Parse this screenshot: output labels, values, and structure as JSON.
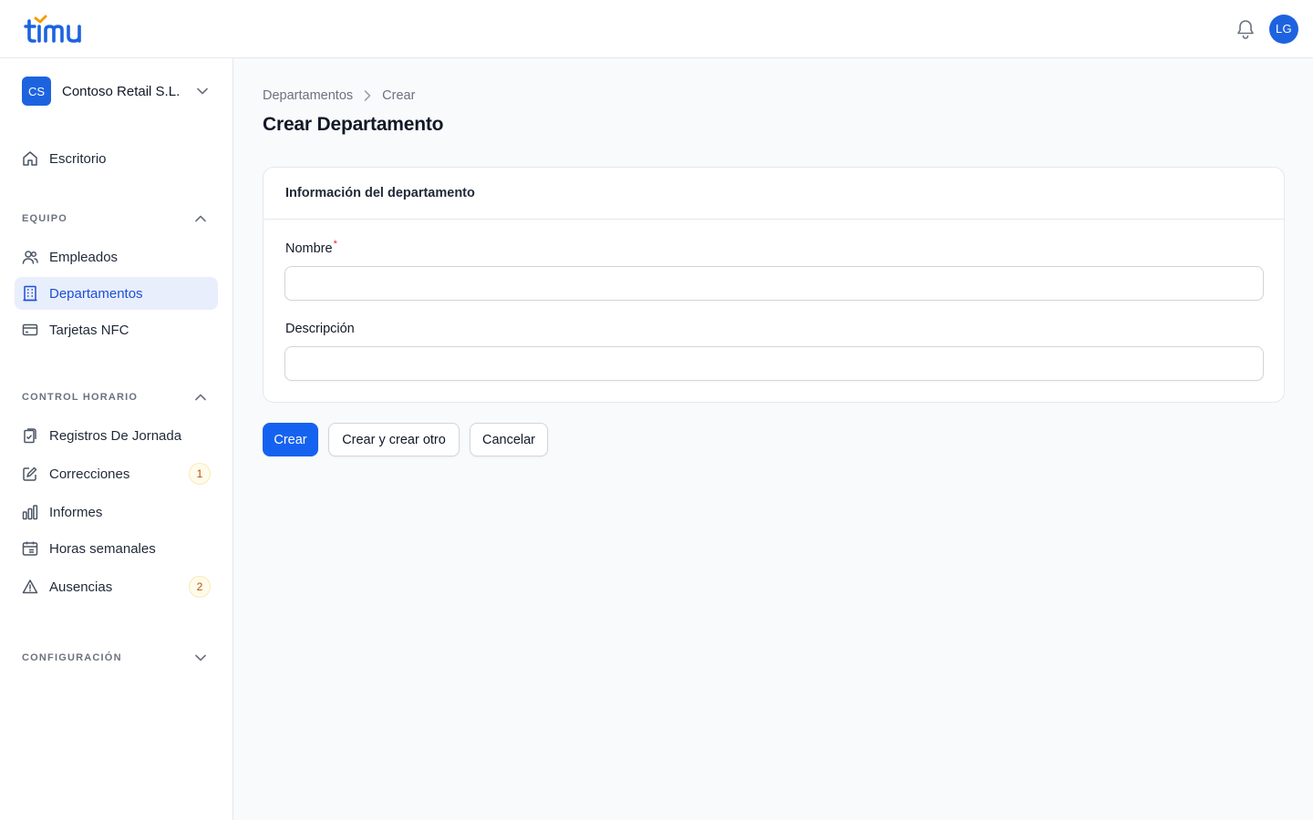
{
  "app": {
    "logo_text": "timu",
    "avatar_initials": "LG",
    "brand_color": "#1d63e0",
    "logo_accent": "#f59e0b"
  },
  "sidebar": {
    "tenant": {
      "initials": "CS",
      "name": "Contoso Retail S.L."
    },
    "home": {
      "label": "Escritorio",
      "icon": "home-icon"
    },
    "groups": [
      {
        "label": "EQUIPO",
        "expanded": true,
        "items": [
          {
            "label": "Empleados",
            "icon": "users-icon"
          },
          {
            "label": "Departamentos",
            "icon": "building-icon",
            "active": true
          },
          {
            "label": "Tarjetas NFC",
            "icon": "credit-card-icon"
          }
        ]
      },
      {
        "label": "CONTROL HORARIO",
        "expanded": true,
        "items": [
          {
            "label": "Registros De Jornada",
            "icon": "clipboard-icon"
          },
          {
            "label": "Correcciones",
            "icon": "edit-icon",
            "badge": "1"
          },
          {
            "label": "Informes",
            "icon": "bar-chart-icon"
          },
          {
            "label": "Horas semanales",
            "icon": "calendar-icon"
          },
          {
            "label": "Ausencias",
            "icon": "warning-icon",
            "badge": "2"
          }
        ]
      },
      {
        "label": "CONFIGURACIÓN",
        "expanded": false,
        "items": []
      }
    ]
  },
  "breadcrumb": {
    "parent": "Departamentos",
    "current": "Crear"
  },
  "page": {
    "title": "Crear Departamento"
  },
  "form": {
    "section_title": "Información del departamento",
    "fields": [
      {
        "label": "Nombre",
        "required": true,
        "value": "",
        "required_mark": "*"
      },
      {
        "label": "Descripción",
        "required": false,
        "value": ""
      }
    ]
  },
  "actions": {
    "create": "Crear",
    "create_another": "Crear y crear otro",
    "cancel": "Cancelar"
  }
}
